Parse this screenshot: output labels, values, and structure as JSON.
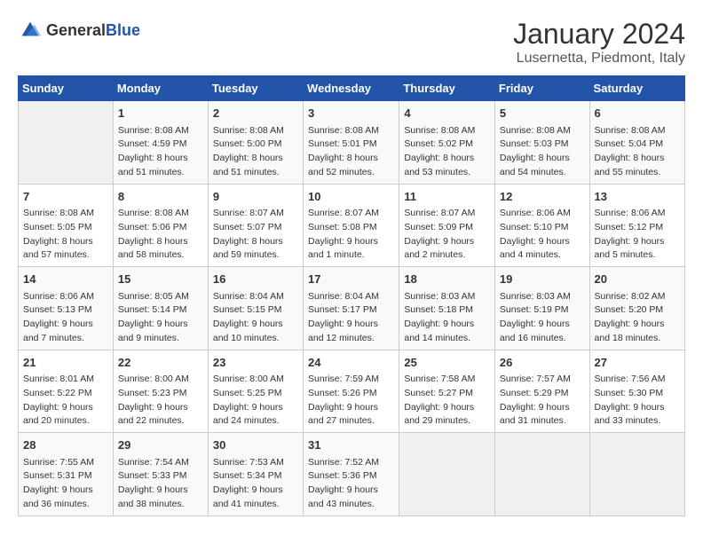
{
  "logo": {
    "general": "General",
    "blue": "Blue"
  },
  "title": {
    "month": "January 2024",
    "location": "Lusernetta, Piedmont, Italy"
  },
  "days_of_week": [
    "Sunday",
    "Monday",
    "Tuesday",
    "Wednesday",
    "Thursday",
    "Friday",
    "Saturday"
  ],
  "weeks": [
    [
      {
        "day": "",
        "sunrise": "",
        "sunset": "",
        "daylight": ""
      },
      {
        "day": "1",
        "sunrise": "Sunrise: 8:08 AM",
        "sunset": "Sunset: 4:59 PM",
        "daylight": "Daylight: 8 hours and 51 minutes."
      },
      {
        "day": "2",
        "sunrise": "Sunrise: 8:08 AM",
        "sunset": "Sunset: 5:00 PM",
        "daylight": "Daylight: 8 hours and 51 minutes."
      },
      {
        "day": "3",
        "sunrise": "Sunrise: 8:08 AM",
        "sunset": "Sunset: 5:01 PM",
        "daylight": "Daylight: 8 hours and 52 minutes."
      },
      {
        "day": "4",
        "sunrise": "Sunrise: 8:08 AM",
        "sunset": "Sunset: 5:02 PM",
        "daylight": "Daylight: 8 hours and 53 minutes."
      },
      {
        "day": "5",
        "sunrise": "Sunrise: 8:08 AM",
        "sunset": "Sunset: 5:03 PM",
        "daylight": "Daylight: 8 hours and 54 minutes."
      },
      {
        "day": "6",
        "sunrise": "Sunrise: 8:08 AM",
        "sunset": "Sunset: 5:04 PM",
        "daylight": "Daylight: 8 hours and 55 minutes."
      }
    ],
    [
      {
        "day": "7",
        "sunrise": "Sunrise: 8:08 AM",
        "sunset": "Sunset: 5:05 PM",
        "daylight": "Daylight: 8 hours and 57 minutes."
      },
      {
        "day": "8",
        "sunrise": "Sunrise: 8:08 AM",
        "sunset": "Sunset: 5:06 PM",
        "daylight": "Daylight: 8 hours and 58 minutes."
      },
      {
        "day": "9",
        "sunrise": "Sunrise: 8:07 AM",
        "sunset": "Sunset: 5:07 PM",
        "daylight": "Daylight: 8 hours and 59 minutes."
      },
      {
        "day": "10",
        "sunrise": "Sunrise: 8:07 AM",
        "sunset": "Sunset: 5:08 PM",
        "daylight": "Daylight: 9 hours and 1 minute."
      },
      {
        "day": "11",
        "sunrise": "Sunrise: 8:07 AM",
        "sunset": "Sunset: 5:09 PM",
        "daylight": "Daylight: 9 hours and 2 minutes."
      },
      {
        "day": "12",
        "sunrise": "Sunrise: 8:06 AM",
        "sunset": "Sunset: 5:10 PM",
        "daylight": "Daylight: 9 hours and 4 minutes."
      },
      {
        "day": "13",
        "sunrise": "Sunrise: 8:06 AM",
        "sunset": "Sunset: 5:12 PM",
        "daylight": "Daylight: 9 hours and 5 minutes."
      }
    ],
    [
      {
        "day": "14",
        "sunrise": "Sunrise: 8:06 AM",
        "sunset": "Sunset: 5:13 PM",
        "daylight": "Daylight: 9 hours and 7 minutes."
      },
      {
        "day": "15",
        "sunrise": "Sunrise: 8:05 AM",
        "sunset": "Sunset: 5:14 PM",
        "daylight": "Daylight: 9 hours and 9 minutes."
      },
      {
        "day": "16",
        "sunrise": "Sunrise: 8:04 AM",
        "sunset": "Sunset: 5:15 PM",
        "daylight": "Daylight: 9 hours and 10 minutes."
      },
      {
        "day": "17",
        "sunrise": "Sunrise: 8:04 AM",
        "sunset": "Sunset: 5:17 PM",
        "daylight": "Daylight: 9 hours and 12 minutes."
      },
      {
        "day": "18",
        "sunrise": "Sunrise: 8:03 AM",
        "sunset": "Sunset: 5:18 PM",
        "daylight": "Daylight: 9 hours and 14 minutes."
      },
      {
        "day": "19",
        "sunrise": "Sunrise: 8:03 AM",
        "sunset": "Sunset: 5:19 PM",
        "daylight": "Daylight: 9 hours and 16 minutes."
      },
      {
        "day": "20",
        "sunrise": "Sunrise: 8:02 AM",
        "sunset": "Sunset: 5:20 PM",
        "daylight": "Daylight: 9 hours and 18 minutes."
      }
    ],
    [
      {
        "day": "21",
        "sunrise": "Sunrise: 8:01 AM",
        "sunset": "Sunset: 5:22 PM",
        "daylight": "Daylight: 9 hours and 20 minutes."
      },
      {
        "day": "22",
        "sunrise": "Sunrise: 8:00 AM",
        "sunset": "Sunset: 5:23 PM",
        "daylight": "Daylight: 9 hours and 22 minutes."
      },
      {
        "day": "23",
        "sunrise": "Sunrise: 8:00 AM",
        "sunset": "Sunset: 5:25 PM",
        "daylight": "Daylight: 9 hours and 24 minutes."
      },
      {
        "day": "24",
        "sunrise": "Sunrise: 7:59 AM",
        "sunset": "Sunset: 5:26 PM",
        "daylight": "Daylight: 9 hours and 27 minutes."
      },
      {
        "day": "25",
        "sunrise": "Sunrise: 7:58 AM",
        "sunset": "Sunset: 5:27 PM",
        "daylight": "Daylight: 9 hours and 29 minutes."
      },
      {
        "day": "26",
        "sunrise": "Sunrise: 7:57 AM",
        "sunset": "Sunset: 5:29 PM",
        "daylight": "Daylight: 9 hours and 31 minutes."
      },
      {
        "day": "27",
        "sunrise": "Sunrise: 7:56 AM",
        "sunset": "Sunset: 5:30 PM",
        "daylight": "Daylight: 9 hours and 33 minutes."
      }
    ],
    [
      {
        "day": "28",
        "sunrise": "Sunrise: 7:55 AM",
        "sunset": "Sunset: 5:31 PM",
        "daylight": "Daylight: 9 hours and 36 minutes."
      },
      {
        "day": "29",
        "sunrise": "Sunrise: 7:54 AM",
        "sunset": "Sunset: 5:33 PM",
        "daylight": "Daylight: 9 hours and 38 minutes."
      },
      {
        "day": "30",
        "sunrise": "Sunrise: 7:53 AM",
        "sunset": "Sunset: 5:34 PM",
        "daylight": "Daylight: 9 hours and 41 minutes."
      },
      {
        "day": "31",
        "sunrise": "Sunrise: 7:52 AM",
        "sunset": "Sunset: 5:36 PM",
        "daylight": "Daylight: 9 hours and 43 minutes."
      },
      {
        "day": "",
        "sunrise": "",
        "sunset": "",
        "daylight": ""
      },
      {
        "day": "",
        "sunrise": "",
        "sunset": "",
        "daylight": ""
      },
      {
        "day": "",
        "sunrise": "",
        "sunset": "",
        "daylight": ""
      }
    ]
  ]
}
